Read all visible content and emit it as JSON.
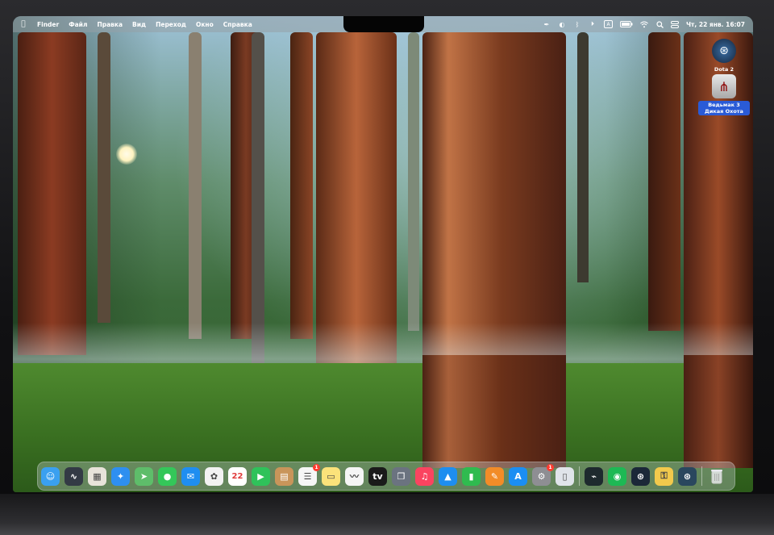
{
  "menubar": {
    "apple_glyph": "",
    "items": [
      "Finder",
      "Файл",
      "Правка",
      "Вид",
      "Переход",
      "Окно",
      "Справка"
    ],
    "status_icons": [
      "pen-icon",
      "app-menu-icon",
      "bluetooth-icon",
      "play-circle-icon",
      "a-input-icon",
      "battery-icon",
      "wifi-icon",
      "search-icon",
      "control-center-icon"
    ],
    "clock": "Чт, 22 янв. 16:07"
  },
  "desktop_icons": [
    {
      "label": "Dota 2",
      "icon": "steam-icon"
    },
    {
      "label": "Ведьмак 3 Дикая Охота",
      "icon": "witcher-icon"
    }
  ],
  "dock": {
    "apps": [
      {
        "name": "finder-icon",
        "glyph": "☺",
        "color": "#3aa0f0"
      },
      {
        "name": "activity-icon",
        "glyph": "∿",
        "color": "#333a45"
      },
      {
        "name": "launchpad-icon",
        "glyph": "▦",
        "color": "#e8e3da"
      },
      {
        "name": "safari-icon",
        "glyph": "✦",
        "color": "#2e8ff0"
      },
      {
        "name": "maps-icon",
        "glyph": "➤",
        "color": "#5ebd6a"
      },
      {
        "name": "messages-icon",
        "glyph": "●",
        "color": "#34c759"
      },
      {
        "name": "mail-icon",
        "glyph": "✉",
        "color": "#1f8ef1"
      },
      {
        "name": "photos-icon",
        "glyph": "✿",
        "color": "#f2f2f2"
      },
      {
        "name": "calendar-icon",
        "glyph": "22",
        "color": "#ffffff"
      },
      {
        "name": "facetime-icon",
        "glyph": "▶",
        "color": "#2fc25a"
      },
      {
        "name": "notes-brown-icon",
        "glyph": "▤",
        "color": "#c9955a"
      },
      {
        "name": "reminders-icon",
        "glyph": "☰",
        "color": "#f6f6f6",
        "badge": "1"
      },
      {
        "name": "notes-icon",
        "glyph": "▭",
        "color": "#fbe27a"
      },
      {
        "name": "freeform-icon",
        "glyph": "〰",
        "color": "#f5f5f5"
      },
      {
        "name": "tv-icon",
        "glyph": "tv",
        "color": "#1a1a1a"
      },
      {
        "name": "speech-icon",
        "glyph": "❐",
        "color": "#6b7380"
      },
      {
        "name": "music-icon",
        "glyph": "♫",
        "color": "#fa4460"
      },
      {
        "name": "keynote-icon",
        "glyph": "▲",
        "color": "#1e8ef0"
      },
      {
        "name": "numbers-icon",
        "glyph": "▮",
        "color": "#2fbb4f"
      },
      {
        "name": "pages-icon",
        "glyph": "✎",
        "color": "#f28c28"
      },
      {
        "name": "app-store-icon",
        "glyph": "A",
        "color": "#1b8ef3"
      },
      {
        "name": "settings-icon",
        "glyph": "⚙",
        "color": "#8e8e93",
        "badge": "1"
      },
      {
        "name": "preview-icon",
        "glyph": "▯",
        "color": "#e0e4ea"
      }
    ],
    "recent": [
      {
        "name": "activity-monitor-icon",
        "glyph": "⌁",
        "color": "#1e2a2e"
      },
      {
        "name": "spotify-icon",
        "glyph": "◉",
        "color": "#1db954"
      },
      {
        "name": "steam-icon",
        "glyph": "⊛",
        "color": "#1b2838"
      },
      {
        "name": "utility-icon",
        "glyph": "⚿",
        "color": "#f2c94c"
      },
      {
        "name": "steam-alt-icon",
        "glyph": "⊛",
        "color": "#2a475e"
      }
    ],
    "trash": {
      "name": "trash-icon",
      "glyph": "🗑"
    }
  },
  "colors": {
    "badge": "#ff3b30"
  }
}
